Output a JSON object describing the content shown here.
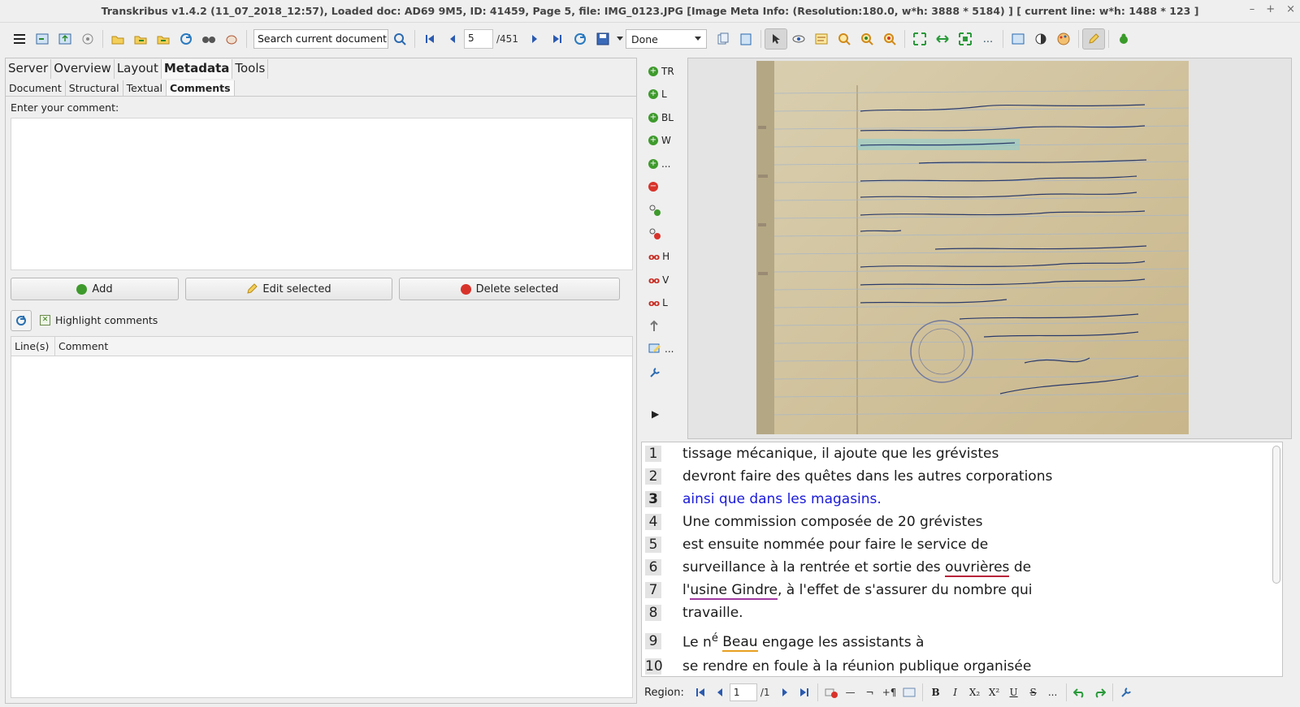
{
  "window": {
    "title": "Transkribus v1.4.2 (11_07_2018_12:57), Loaded doc: AD69 9M5, ID: 41459, Page 5, file: IMG_0123.JPG [Image Meta Info: (Resolution:180.0, w*h: 3888 * 5184) ] [ current line: w*h: 1488 * 123 ]",
    "controls": [
      "–",
      "+",
      "×"
    ]
  },
  "toolbar": {
    "search_placeholder": "Search current document...",
    "page_current": "5",
    "page_total": "/451",
    "status": "Done",
    "more": "..."
  },
  "left": {
    "main_tabs": [
      "Server",
      "Overview",
      "Layout",
      "Metadata",
      "Tools"
    ],
    "active_main_tab": "Metadata",
    "sub_tabs": [
      "Document",
      "Structural",
      "Textual",
      "Comments"
    ],
    "active_sub_tab": "Comments",
    "comment_label": "Enter your comment:",
    "comment_value": "",
    "buttons": {
      "add": "Add",
      "edit": "Edit selected",
      "delete": "Delete selected"
    },
    "highlight_label": "Highlight comments",
    "highlight_checked": true,
    "table_headers": [
      "Line(s)",
      "Comment"
    ]
  },
  "vtools": {
    "tr": "TR",
    "l": "L",
    "bl": "BL",
    "w": "W",
    "more": "...",
    "h": "H",
    "v": "V",
    "l2": "L",
    "more2": "...",
    "expand": "▶"
  },
  "transcription": {
    "current_line": 3,
    "lines": [
      {
        "n": "1",
        "text": "tissage mécanique, il ajoute que les grévistes"
      },
      {
        "n": "2",
        "text": "devront faire des quêtes dans les autres corporations"
      },
      {
        "n": "3",
        "text": "ainsi que dans les magasins."
      },
      {
        "n": "4",
        "text": "Une commission composée de 20 grévistes"
      },
      {
        "n": "5",
        "text": "est ensuite nommée pour faire le service de"
      },
      {
        "n": "6",
        "text_a": "surveillance à la rentrée et sortie des ",
        "text_b": "ouvrières",
        "text_c": " de"
      },
      {
        "n": "7",
        "text_a": "l'",
        "text_b": "usine Gindre",
        "text_c": ", à l'effet de s'assurer du nombre qui"
      },
      {
        "n": "8",
        "text": "travaille."
      },
      {
        "n": "9",
        "text_a": "Le n",
        "sup": "é",
        "text_b": "Beau",
        "text_c": " engage les assistants à"
      },
      {
        "n": "10",
        "text": "se rendre en foule à la réunion publique organisée"
      }
    ]
  },
  "bottombar": {
    "region_label": "Region:",
    "region_current": "1",
    "region_total": "/1",
    "more": "..."
  },
  "colors": {
    "current_line_text": "#1a1ad8",
    "paper": "#d5c49a",
    "ink": "#2a3a6a"
  }
}
